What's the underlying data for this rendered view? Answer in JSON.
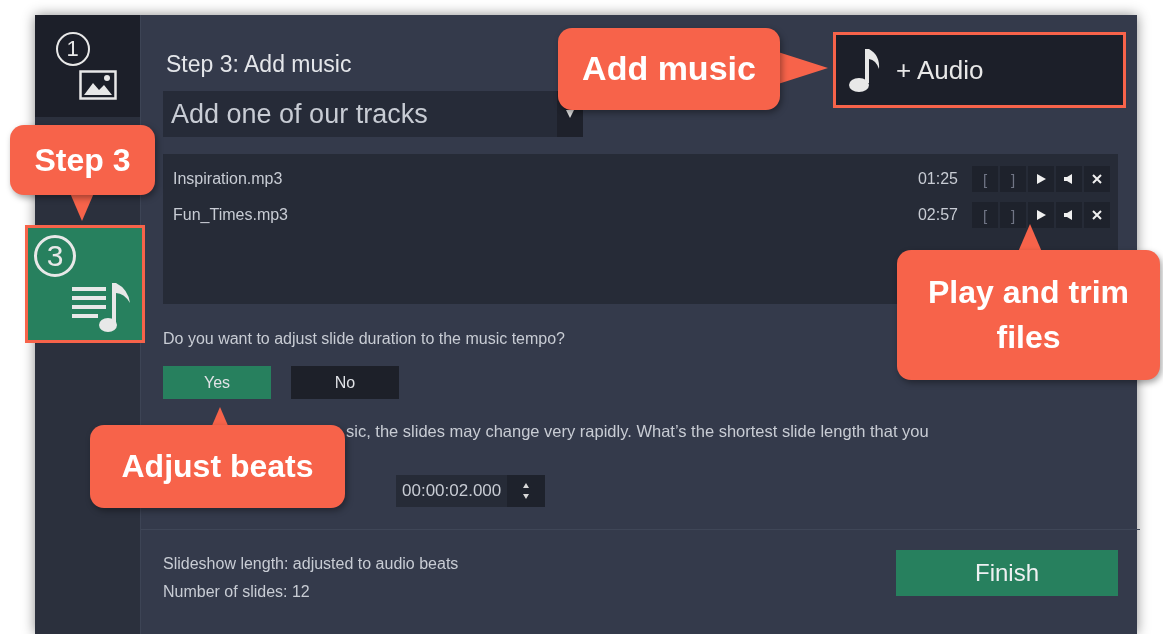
{
  "sidebar": {
    "steps": [
      {
        "number": "1",
        "kind": "photos",
        "selected": false,
        "highlighted": false
      },
      {
        "number": "3",
        "kind": "music",
        "selected": true,
        "highlighted": true
      }
    ]
  },
  "title": "Step 3: Add music",
  "track_dropdown": {
    "value": "Add one of our tracks"
  },
  "audio_button": {
    "label": "+ Audio",
    "highlighted": true
  },
  "tracks": [
    {
      "name": "Inspiration.mp3",
      "duration": "01:25",
      "trim_start": "[",
      "trim_end": "]"
    },
    {
      "name": "Fun_Times.mp3",
      "duration": "02:57",
      "trim_start": "[",
      "trim_end": "]"
    }
  ],
  "question": "Do you want to adjust slide duration to the music tempo?",
  "answers": [
    {
      "label": "Yes",
      "selected": true
    },
    {
      "label": "No",
      "selected": false
    }
  ],
  "note": "sic, the slides may change very rapidly. What’s the shortest slide length that you",
  "min_duration": {
    "value": "00:00:02.000"
  },
  "summary": [
    "Slideshow length: adjusted to audio beats",
    "Number of slides: 12"
  ],
  "finish_button": "Finish",
  "callouts": [
    {
      "text": "Add music",
      "kind": "pointing-right"
    },
    {
      "text": "Step 3",
      "kind": "pointing-down"
    },
    {
      "text": "Play and trim files",
      "kind": "pointing-up"
    },
    {
      "text": "Adjust beats",
      "kind": "pointing-up"
    }
  ]
}
